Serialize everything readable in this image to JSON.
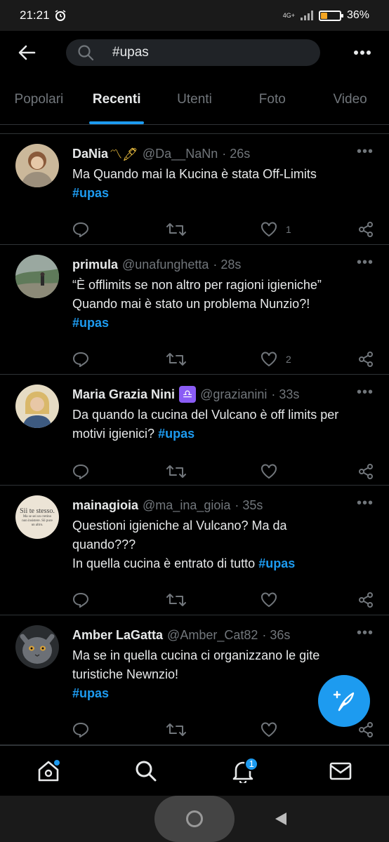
{
  "status_bar": {
    "time": "21:21",
    "network": "4G+",
    "battery": "36%",
    "battery_level": 0.36
  },
  "top_bar": {
    "search_value": "#upas"
  },
  "tabs": [
    {
      "label": "Popolari",
      "active": false
    },
    {
      "label": "Recenti",
      "active": true
    },
    {
      "label": "Utenti",
      "active": false
    },
    {
      "label": "Foto",
      "active": false
    },
    {
      "label": "Video",
      "active": false
    }
  ],
  "tweets": [
    {
      "name": "DaNia",
      "name_decor": "〽🖋",
      "handle": "@Da__NaNn",
      "time": "· 26s",
      "text_lines": [
        "Ma Quando mai la Kucina è stata Off-Limits"
      ],
      "hashtag": "#upas",
      "likes": "1",
      "avatar_color": "#b59a7a"
    },
    {
      "name": "primula",
      "handle": "@unafunghetta",
      "time": "· 28s",
      "text_lines": [
        "“È offlimits se non altro per ragioni igieniche”",
        "Quando mai è stato un problema Nunzio?!"
      ],
      "hashtag": "#upas",
      "likes": "2",
      "avatar_color": "#7b8c78"
    },
    {
      "name": "Maria Grazia Nini",
      "name_badge": "♎",
      "handle": "@grazianini",
      "time": "· 33s",
      "text_lines": [
        "Da quando la cucina del Vulcano è off limits per",
        "motivi igienici?"
      ],
      "hashtag": "#upas",
      "likes": "",
      "avatar_color": "#d9c9a8"
    },
    {
      "name": "mainagioia",
      "handle": "@ma_ina_gioia",
      "time": "· 35s",
      "text_lines": [
        "Questioni igieniche al Vulcano? Ma da",
        "quando???",
        "In quella cucina è entrato di tutto"
      ],
      "hashtag": "#upas",
      "likes": "",
      "avatar_text": [
        "Sii te stesso.",
        "Ma se sei un cretino",
        "non insistere. Sii pure",
        "un altro."
      ],
      "avatar_color": "#ece4d6"
    },
    {
      "name": "Amber LaGatta",
      "handle": "@Amber_Cat82",
      "time": "· 36s",
      "text_lines": [
        "Ma se in quella cucina ci organizzano le gite",
        "turistiche Newnzio!"
      ],
      "hashtag": "#upas",
      "likes": "",
      "avatar_color": "#5e6266"
    }
  ],
  "bottom_nav": {
    "notifications_count": "1"
  },
  "colors": {
    "accent": "#1d9bf0",
    "background": "#000000",
    "muted": "#71767b",
    "text": "#e7e9ea"
  }
}
